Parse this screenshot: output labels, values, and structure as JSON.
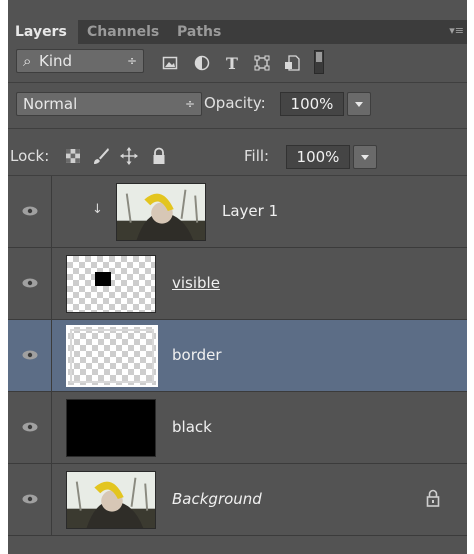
{
  "panel": {
    "tabs": [
      {
        "label": "Layers",
        "active": true
      },
      {
        "label": "Channels",
        "active": false
      },
      {
        "label": "Paths",
        "active": false
      }
    ],
    "menu_icon": "panel-menu-icon"
  },
  "filter": {
    "search_icon": "search-icon",
    "kind_label": "Kind",
    "spinner": "÷",
    "icons": [
      "image-filter-icon",
      "adjustment-filter-icon",
      "type-filter-icon",
      "shape-filter-icon",
      "smart-object-filter-icon",
      "filter-toggle-icon"
    ]
  },
  "blend": {
    "mode": "Normal",
    "spinner": "÷",
    "opacity_label": "Opacity:",
    "opacity_value": "100%"
  },
  "lock": {
    "label": "Lock:",
    "icons": [
      "lock-transparent-icon",
      "lock-image-icon",
      "lock-position-icon",
      "lock-all-icon"
    ],
    "fill_label": "Fill:",
    "fill_value": "100%"
  },
  "layers": [
    {
      "name": "Layer 1",
      "clipped": true,
      "thumb": "photo",
      "selected": false
    },
    {
      "name": "visible",
      "clipped": false,
      "thumb": "checker-square",
      "selected": false,
      "underlined": true
    },
    {
      "name": "border",
      "clipped": false,
      "thumb": "checker-frame",
      "selected": true
    },
    {
      "name": "black",
      "clipped": false,
      "thumb": "black",
      "selected": false
    },
    {
      "name": "Background",
      "clipped": false,
      "thumb": "photo",
      "selected": false,
      "italic": true,
      "locked": true
    }
  ],
  "colors": {
    "panel_bg": "#535353",
    "selected_row": "#5c6d86",
    "tab_bar": "#3c3c3c"
  }
}
